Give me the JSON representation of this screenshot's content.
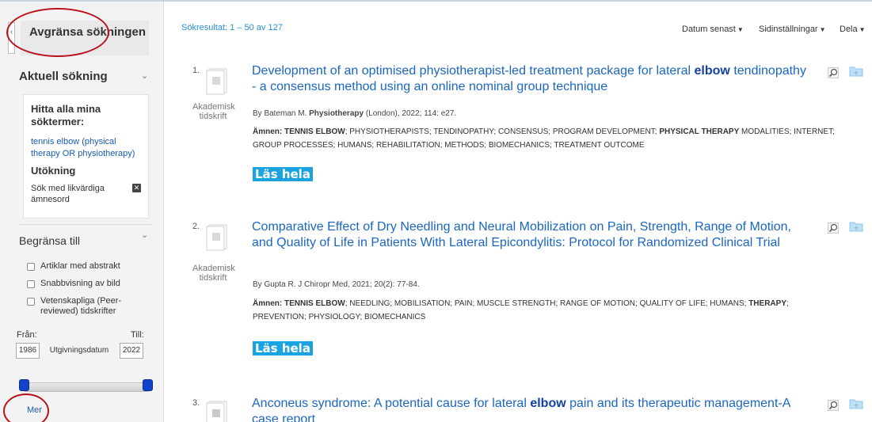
{
  "sidebar": {
    "header": "Avgränsa sökningen",
    "current_search": {
      "title": "Aktuell sökning",
      "find_all_heading": "Hitta alla mina söktermer:",
      "query": "tennis elbow (physical therapy OR physiotherapy)",
      "expansion_heading": "Utökning",
      "expansion_item": "Sök med likvärdiga ämnesord"
    },
    "limit": {
      "title": "Begränsa till",
      "options": [
        {
          "label": "Artiklar med abstrakt"
        },
        {
          "label": "Snabbvisning av bild"
        },
        {
          "label": "Vetenskapliga (Peer-reviewed) tidskrifter"
        }
      ],
      "from_label": "Från:",
      "to_label": "Till:",
      "from_year": "1986",
      "to_year": "2022",
      "range_field_label": "Utgivningsdatum",
      "more_link": "Mer"
    }
  },
  "main": {
    "results_count": "Sökresultat: 1 – 50 av 127",
    "toolbar": {
      "sort": "Datum senast",
      "page_options": "Sidinställningar",
      "share": "Dela"
    },
    "results": [
      {
        "num": "1.",
        "doc_type": "Akademisk tidskrift",
        "title_before": "Development of an optimised physiotherapist-led treatment package for lateral ",
        "title_highlight": "elbow",
        "title_after": " tendinopathy - a consensus method using an online nominal group technique",
        "author": "By Bateman M.",
        "journal": "Physiotherapy",
        "citation": " (London), 2022; 114: e27.",
        "subjects_label": "Ämnen:",
        "subjects_html": " <b>TENNIS ELBOW</b>; PHYSIOTHERAPISTS; TENDINOPATHY; CONSENSUS; PROGRAM DEVELOPMENT; <b>PHYSICAL THERAPY</b> MODALITIES; INTERNET; GROUP PROCESSES; HUMANS; REHABILITATION; METHODS; BIOMECHANICS; TREATMENT OUTCOME",
        "full_text": "Läs hela"
      },
      {
        "num": "2.",
        "doc_type": "Akademisk tidskrift",
        "title_before": "Comparative Effect of Dry Needling and Neural Mobilization on Pain, Strength, Range of Motion, and Quality of Life in Patients With Lateral Epicondylitis: Protocol for Randomized Clinical Trial",
        "title_highlight": "",
        "title_after": "",
        "author": "By Gupta R. J Chiropr Med, 2021; 20(2): 77-84.",
        "journal": "",
        "citation": "",
        "subjects_label": "Ämnen:",
        "subjects_html": " <b>TENNIS ELBOW</b>; NEEDLING; MOBILISATION; PAIN; MUSCLE STRENGTH; RANGE OF MOTION; QUALITY OF LIFE; HUMANS; <b>THERAPY</b>; PREVENTION; PHYSIOLOGY; BIOMECHANICS",
        "full_text": "Läs hela"
      },
      {
        "num": "3.",
        "title_before": "Anconeus syndrome: A potential cause for lateral ",
        "title_highlight": "elbow",
        "title_after": " pain and its therapeutic management-A case report"
      }
    ]
  },
  "colors": {
    "link": "#1a66c2",
    "accent": "#2a8dd4",
    "full_text_bg": "#1aa3e0",
    "annotation": "#b8121a",
    "slider": "#1144cc"
  },
  "icons": [
    "collapse-arrow-icon",
    "chevron-down-icon",
    "close-icon",
    "document-icon",
    "magnifier-icon",
    "folder-add-icon"
  ]
}
